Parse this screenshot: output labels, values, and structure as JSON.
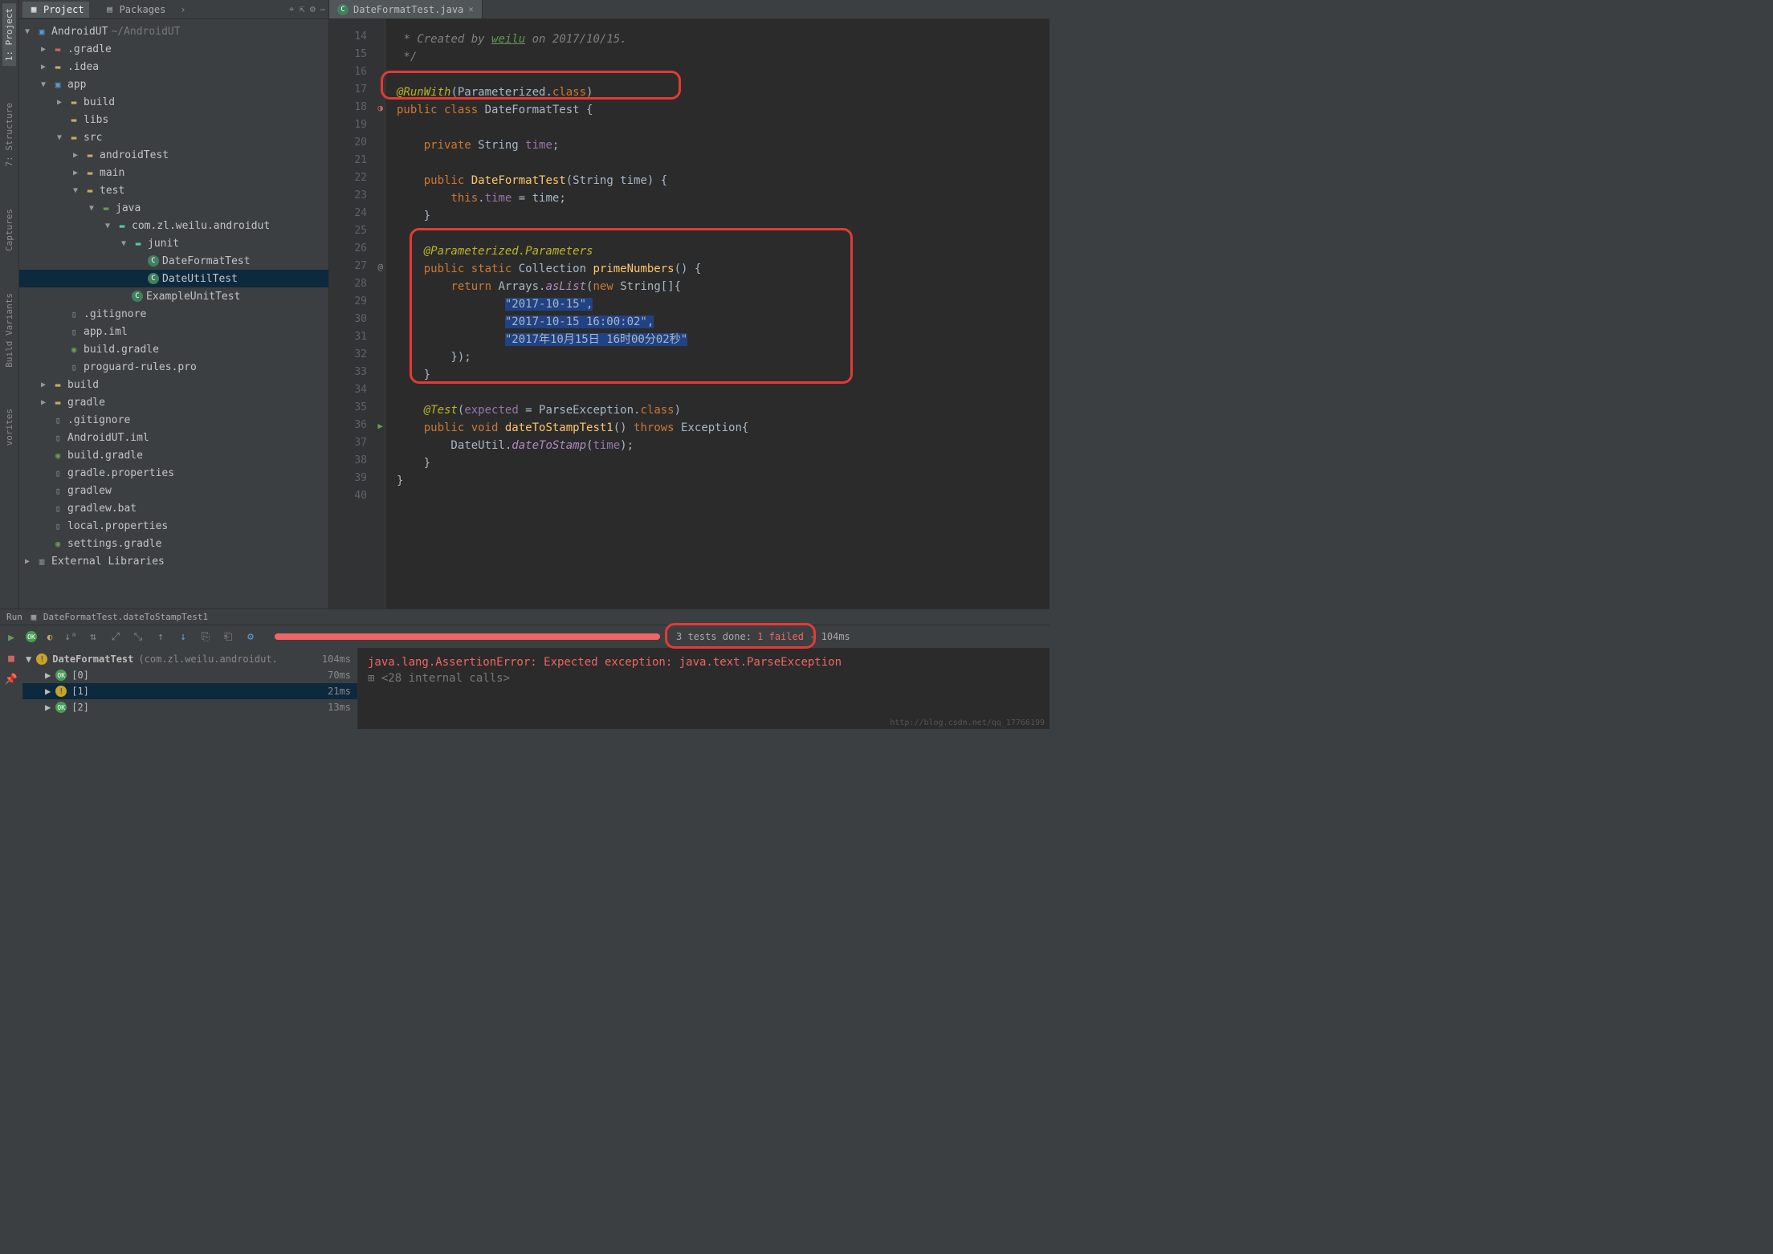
{
  "leftStrip": {
    "tabs": [
      "1: Project",
      "7: Structure",
      "Captures",
      "Build Variants",
      "vorites"
    ]
  },
  "panel": {
    "tabs": {
      "project": "Project",
      "packages": "Packages"
    },
    "root": {
      "name": "AndroidUT",
      "path": "~/AndroidUT"
    },
    "nodes": {
      "gradleDir": ".gradle",
      "idea": ".idea",
      "app": "app",
      "buildDir": "build",
      "libs": "libs",
      "src": "src",
      "androidTest": "androidTest",
      "mainSrc": "main",
      "test": "test",
      "java": "java",
      "pkg": "com.zl.weilu.androidut",
      "junit": "junit",
      "cls1": "DateFormatTest",
      "cls2": "DateUtilTest",
      "cls3": "ExampleUnitTest",
      "gitignore": ".gitignore",
      "appIml": "app.iml",
      "buildGradle": "build.gradle",
      "proguard": "proguard-rules.pro",
      "buildTop": "build",
      "gradleTop": "gradle",
      "gitignoreTop": ".gitignore",
      "projIml": "AndroidUT.iml",
      "buildGradleTop": "build.gradle",
      "gradleProps": "gradle.properties",
      "gradlew": "gradlew",
      "gradlewBat": "gradlew.bat",
      "localProps": "local.properties",
      "settingsGradle": "settings.gradle",
      "extLibs": "External Libraries"
    }
  },
  "editor": {
    "tab": "DateFormatTest.java",
    "startLine": 14,
    "lines": [
      {
        "n": 14,
        "html": " <span class='cmt'>* Created by </span><span class='link'>weilu</span><span class='cmt'> on 2017/10/15.</span>"
      },
      {
        "n": 15,
        "html": " <span class='cmt'>*/</span>"
      },
      {
        "n": 16,
        "html": ""
      },
      {
        "n": 17,
        "html": "<span class='ann'>@RunWith</span>(Parameterized.<span class='k'>class</span>)"
      },
      {
        "n": 18,
        "html": "<span class='k'>public class</span> DateFormatTest {"
      },
      {
        "n": 19,
        "html": ""
      },
      {
        "n": 20,
        "html": "    <span class='k'>private</span> String <span class='id'>time</span>;"
      },
      {
        "n": 21,
        "html": ""
      },
      {
        "n": 22,
        "html": "    <span class='k'>public</span> <span class='fn'>DateFormatTest</span>(String time) {"
      },
      {
        "n": 23,
        "html": "        <span class='k'>this</span>.<span class='id'>time</span> = time;"
      },
      {
        "n": 24,
        "html": "    }"
      },
      {
        "n": 25,
        "html": ""
      },
      {
        "n": 26,
        "html": "    <span class='ann'>@Parameterized.Parameters</span>"
      },
      {
        "n": 27,
        "html": "    <span class='k'>public static</span> Collection <span class='fn'>primeNumbers</span>() {"
      },
      {
        "n": 28,
        "html": "        <span class='k'>return</span> Arrays.<span class='fni'>asList</span>(<span class='k'>new</span> String[]{"
      },
      {
        "n": 29,
        "html": "                <span class='sselect'>\"2017-10-15\"</span><span class='sselect'>,</span>"
      },
      {
        "n": 30,
        "html": "                <span class='sselect'>\"2017-10-15 16:00:02\"</span><span class='sselect'>,</span>"
      },
      {
        "n": 31,
        "html": "                <span class='sselect'>\"2017年10月15日 16时00分02秒\"</span>"
      },
      {
        "n": 32,
        "html": "        });"
      },
      {
        "n": 33,
        "html": "    }"
      },
      {
        "n": 34,
        "html": ""
      },
      {
        "n": 35,
        "html": "    <span class='ann'>@Test</span>(<span class='id'>expected</span> = ParseException.<span class='k'>class</span>)"
      },
      {
        "n": 36,
        "html": "    <span class='k'>public void</span> <span class='fn'>dateToStampTest1</span>() <span class='k'>throws</span> Exception{"
      },
      {
        "n": 37,
        "html": "        DateUtil.<span class='fni'>dateToStamp</span>(<span class='id'>time</span>);"
      },
      {
        "n": 38,
        "html": "    }"
      },
      {
        "n": 39,
        "html": "}"
      },
      {
        "n": 40,
        "html": ""
      }
    ]
  },
  "run": {
    "header": "Run",
    "title": "DateFormatTest.dateToStampTest1",
    "summary": {
      "done": "3 tests done:",
      "failed": "1 failed",
      "time": "104ms"
    },
    "tree": {
      "root": {
        "name": "DateFormatTest",
        "pkg": "(com.zl.weilu.androidut.",
        "time": "104ms"
      },
      "items": [
        {
          "name": "[0]",
          "time": "70ms",
          "status": "ok"
        },
        {
          "name": "[1]",
          "time": "21ms",
          "status": "warn"
        },
        {
          "name": "[2]",
          "time": "13ms",
          "status": "ok"
        }
      ]
    },
    "console": {
      "err": "java.lang.AssertionError: Expected exception: java.text.ParseException",
      "calls": "<28 internal calls>"
    }
  },
  "watermark": "http://blog.csdn.net/qq_17766199"
}
